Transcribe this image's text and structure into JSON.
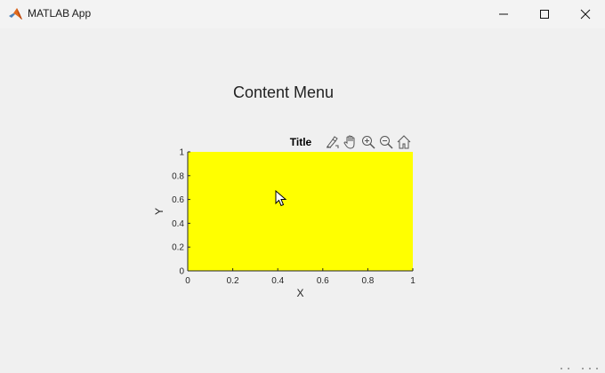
{
  "window": {
    "title": "MATLAB App",
    "logo_icon": "matlab-logo-icon",
    "controls": [
      "minimize-icon",
      "maximize-icon",
      "close-icon"
    ]
  },
  "main": {
    "heading": "Content Menu"
  },
  "axes": {
    "title": "Title",
    "xlabel": "X",
    "ylabel": "Y",
    "xlim": [
      0,
      1
    ],
    "ylim": [
      0,
      1
    ],
    "xticks": [
      "0",
      "0.2",
      "0.4",
      "0.6",
      "0.8",
      "1"
    ],
    "yticks": [
      "0",
      "0.2",
      "0.4",
      "0.6",
      "0.8",
      "1"
    ],
    "background_color": "#ffff00",
    "toolbar_icons": [
      "brush-icon",
      "pan-hand-icon",
      "zoom-in-icon",
      "zoom-out-icon",
      "home-icon"
    ]
  }
}
